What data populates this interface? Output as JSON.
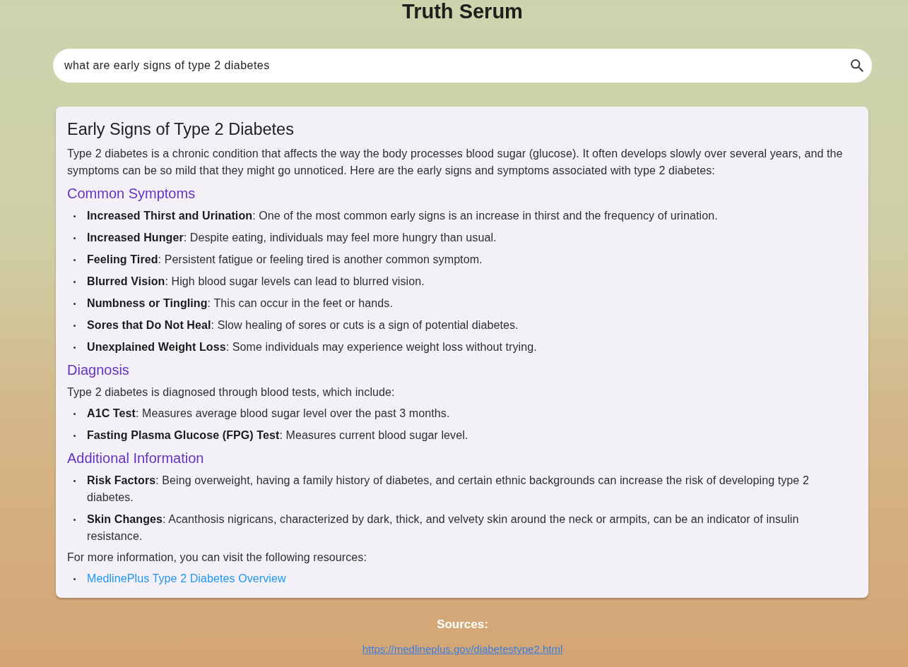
{
  "app": {
    "title": "Truth Serum"
  },
  "search": {
    "value": "what are early signs of type 2 diabetes"
  },
  "answer": {
    "title": "Early Signs of Type 2 Diabetes",
    "blocks": [
      {
        "kind": "paragraph",
        "text": "Type 2 diabetes is a chronic condition that affects the way the body processes blood sugar (glucose). It often develops slowly over several years, and the symptoms can be so mild that they might go unnoticed. Here are the early signs and symptoms associated with type 2 diabetes:"
      },
      {
        "kind": "heading",
        "text": "Common Symptoms"
      },
      {
        "kind": "list",
        "items": [
          {
            "text": "**Increased Thirst and Urination**: One of the most common early signs is an increase in thirst and the frequency of urination."
          },
          {
            "text": "**Increased Hunger**: Despite eating, individuals may feel more hungry than usual."
          },
          {
            "text": "**Feeling Tired**: Persistent fatigue or feeling tired is another common symptom."
          },
          {
            "text": "**Blurred Vision**: High blood sugar levels can lead to blurred vision."
          },
          {
            "text": "**Numbness or Tingling**: This can occur in the feet or hands."
          },
          {
            "text": "**Sores that Do Not Heal**: Slow healing of sores or cuts is a sign of potential diabetes."
          },
          {
            "text": "**Unexplained Weight Loss**: Some individuals may experience weight loss without trying."
          }
        ]
      },
      {
        "kind": "heading",
        "text": "Diagnosis"
      },
      {
        "kind": "paragraph",
        "text": "Type 2 diabetes is diagnosed through blood tests, which include:"
      },
      {
        "kind": "list",
        "items": [
          {
            "text": "**A1C Test**: Measures average blood sugar level over the past 3 months."
          },
          {
            "text": "**Fasting Plasma Glucose (FPG) Test**: Measures current blood sugar level."
          }
        ]
      },
      {
        "kind": "heading",
        "text": "Additional Information"
      },
      {
        "kind": "list",
        "items": [
          {
            "text": "**Risk Factors**: Being overweight, having a family history of diabetes, and certain ethnic backgrounds can increase the risk of developing type 2 diabetes."
          },
          {
            "text": "**Skin Changes**: Acanthosis nigricans, characterized by dark, thick, and velvety skin around the neck or armpits, can be an indicator of insulin resistance."
          }
        ]
      },
      {
        "kind": "paragraph",
        "text": "For more information, you can visit the following resources:"
      },
      {
        "kind": "links",
        "items": [
          {
            "text": "MedlinePlus Type 2 Diabetes Overview"
          }
        ]
      }
    ]
  },
  "sources": {
    "heading": "Sources:",
    "links": [
      "https://medlineplus.gov/diabetestype2.html"
    ]
  }
}
